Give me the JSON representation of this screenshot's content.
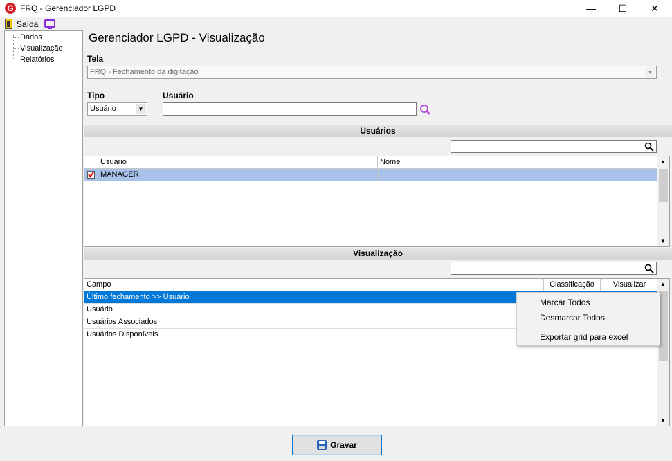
{
  "window": {
    "title": "FRQ - Gerenciador LGPD",
    "minimize": "—",
    "maximize": "☐",
    "close": "✕"
  },
  "menubar": {
    "exit_label": "Saída"
  },
  "tree": {
    "items": [
      "Dados",
      "Visualização",
      "Relatórios"
    ]
  },
  "page_title": "Gerenciador LGPD - Visualização",
  "tela": {
    "label": "Tela",
    "value": "FRQ - Fechamento da digitação"
  },
  "tipo": {
    "label": "Tipo",
    "value": "Usuário"
  },
  "usuario": {
    "label": "Usuário",
    "value": ""
  },
  "users_section": {
    "title": "Usuários",
    "search_value": "",
    "columns": [
      "Usuário",
      "Nome"
    ],
    "rows": [
      {
        "checked": true,
        "usuario": "MANAGER",
        "nome": ""
      }
    ]
  },
  "view_section": {
    "title": "Visualização",
    "search_value": "",
    "columns": [
      "Campo",
      "Classificação",
      "Visualizar"
    ],
    "rows": [
      "Último fechamento >> Usuário",
      "Usuário",
      "Usuários Associados",
      "Usuários Disponíveis"
    ]
  },
  "context_menu": {
    "items": [
      "Marcar Todos",
      "Desmarcar Todos",
      "Exportar grid para excel"
    ]
  },
  "footer": {
    "save_label": "Gravar"
  },
  "colors": {
    "selection": "#0078d7",
    "user_row": "#a9c2ea",
    "accent": "#8a2be2"
  }
}
